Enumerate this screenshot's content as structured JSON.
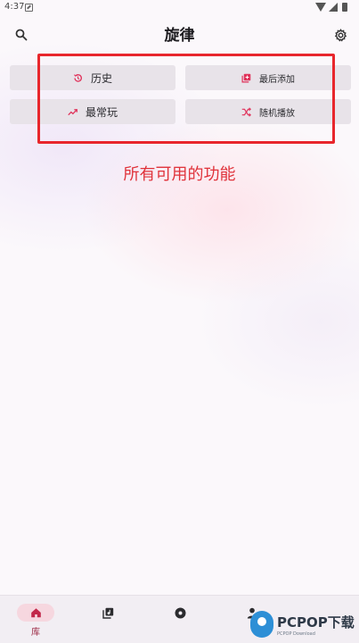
{
  "status_bar": {
    "time": "4:37"
  },
  "app_bar": {
    "title": "旋律"
  },
  "features": {
    "history": {
      "label": "历史",
      "icon": "history-icon"
    },
    "recently_added": {
      "label": "最后添加",
      "icon": "library-add-icon"
    },
    "most_played": {
      "label": "最常玩",
      "icon": "trending-up-icon"
    },
    "shuffle": {
      "label": "随机播放",
      "icon": "shuffle-icon"
    }
  },
  "annotation": {
    "text": "所有可用的功能"
  },
  "bottom_nav": {
    "library": {
      "label": "库",
      "icon": "home-icon",
      "selected": true
    },
    "playlists": {
      "label": "",
      "icon": "playlist-icon"
    },
    "albums": {
      "label": "",
      "icon": "album-icon"
    },
    "artists": {
      "label": "",
      "icon": "person-icon"
    }
  },
  "watermark": {
    "brand": "PCPOP下载",
    "sub": "PCPOP Download"
  },
  "colors": {
    "accent": "#e0325a",
    "annotation": "#e8262c",
    "button_bg": "#e8e3e9",
    "nav_pill": "#f6d7df"
  }
}
